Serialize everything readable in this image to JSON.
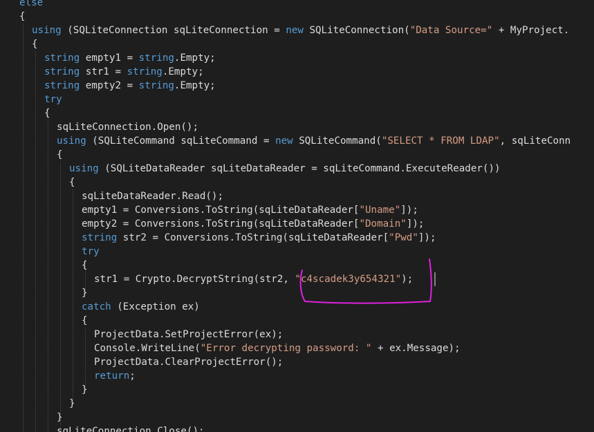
{
  "editor": {
    "theme": {
      "background": "#1e1e1e",
      "keyword": "#569cd6",
      "string": "#d69d85",
      "plain": "#dcdcdc",
      "annotation": "#e020e0"
    },
    "lines": [
      [
        {
          "t": "kw",
          "v": "else"
        }
      ],
      [
        {
          "t": "plain",
          "v": "{"
        }
      ],
      [
        {
          "t": "kw",
          "v": "using"
        },
        {
          "t": "plain",
          "v": " (SQLiteConnection sqLiteConnection = "
        },
        {
          "t": "kw",
          "v": "new"
        },
        {
          "t": "plain",
          "v": " SQLiteConnection("
        },
        {
          "t": "str",
          "v": "\"Data Source=\""
        },
        {
          "t": "plain",
          "v": " + MyProject."
        }
      ],
      [
        {
          "t": "plain",
          "v": "{"
        }
      ],
      [
        {
          "t": "kw",
          "v": "string"
        },
        {
          "t": "plain",
          "v": " empty1 = "
        },
        {
          "t": "kw",
          "v": "string"
        },
        {
          "t": "plain",
          "v": ".Empty;"
        }
      ],
      [
        {
          "t": "kw",
          "v": "string"
        },
        {
          "t": "plain",
          "v": " str1 = "
        },
        {
          "t": "kw",
          "v": "string"
        },
        {
          "t": "plain",
          "v": ".Empty;"
        }
      ],
      [
        {
          "t": "kw",
          "v": "string"
        },
        {
          "t": "plain",
          "v": " empty2 = "
        },
        {
          "t": "kw",
          "v": "string"
        },
        {
          "t": "plain",
          "v": ".Empty;"
        }
      ],
      [
        {
          "t": "kw",
          "v": "try"
        }
      ],
      [
        {
          "t": "plain",
          "v": "{"
        }
      ],
      [
        {
          "t": "plain",
          "v": "sqLiteConnection.Open();"
        }
      ],
      [
        {
          "t": "kw",
          "v": "using"
        },
        {
          "t": "plain",
          "v": " (SQLiteCommand sqLiteCommand = "
        },
        {
          "t": "kw",
          "v": "new"
        },
        {
          "t": "plain",
          "v": " SQLiteCommand("
        },
        {
          "t": "str",
          "v": "\"SELECT * FROM LDAP\""
        },
        {
          "t": "plain",
          "v": ", sqLiteConn"
        }
      ],
      [
        {
          "t": "plain",
          "v": "{"
        }
      ],
      [
        {
          "t": "kw",
          "v": "using"
        },
        {
          "t": "plain",
          "v": " (SQLiteDataReader sqLiteDataReader = sqLiteCommand.ExecuteReader())"
        }
      ],
      [
        {
          "t": "plain",
          "v": "{"
        }
      ],
      [
        {
          "t": "plain",
          "v": "sqLiteDataReader.Read();"
        }
      ],
      [
        {
          "t": "plain",
          "v": "empty1 = Conversions.ToString(sqLiteDataReader["
        },
        {
          "t": "str",
          "v": "\"Uname\""
        },
        {
          "t": "plain",
          "v": "]);"
        }
      ],
      [
        {
          "t": "plain",
          "v": "empty2 = Conversions.ToString(sqLiteDataReader["
        },
        {
          "t": "str",
          "v": "\"Domain\""
        },
        {
          "t": "plain",
          "v": "]);"
        }
      ],
      [
        {
          "t": "kw",
          "v": "string"
        },
        {
          "t": "plain",
          "v": " str2 = Conversions.ToString(sqLiteDataReader["
        },
        {
          "t": "str",
          "v": "\"Pwd\""
        },
        {
          "t": "plain",
          "v": "]);"
        }
      ],
      [
        {
          "t": "kw",
          "v": "try"
        }
      ],
      [
        {
          "t": "plain",
          "v": "{"
        }
      ],
      [
        {
          "t": "plain",
          "v": "str1 = Crypto.DecryptString(str2, "
        },
        {
          "t": "str",
          "v": "\"c4scadek3y654321\""
        },
        {
          "t": "plain",
          "v": ");"
        }
      ],
      [
        {
          "t": "plain",
          "v": "}"
        }
      ],
      [
        {
          "t": "kw",
          "v": "catch"
        },
        {
          "t": "plain",
          "v": " (Exception ex)"
        }
      ],
      [
        {
          "t": "plain",
          "v": "{"
        }
      ],
      [
        {
          "t": "plain",
          "v": "ProjectData.SetProjectError(ex);"
        }
      ],
      [
        {
          "t": "plain",
          "v": "Console.WriteLine("
        },
        {
          "t": "str",
          "v": "\"Error decrypting password: \""
        },
        {
          "t": "plain",
          "v": " + ex.Message);"
        }
      ],
      [
        {
          "t": "plain",
          "v": "ProjectData.ClearProjectError();"
        }
      ],
      [
        {
          "t": "kw",
          "v": "return"
        },
        {
          "t": "plain",
          "v": ";"
        }
      ],
      [
        {
          "t": "plain",
          "v": "}"
        }
      ],
      [
        {
          "t": "plain",
          "v": "}"
        }
      ],
      [
        {
          "t": "plain",
          "v": "}"
        }
      ],
      [
        {
          "t": "plain",
          "v": "sqLiteConnection.Close();"
        }
      ]
    ]
  }
}
